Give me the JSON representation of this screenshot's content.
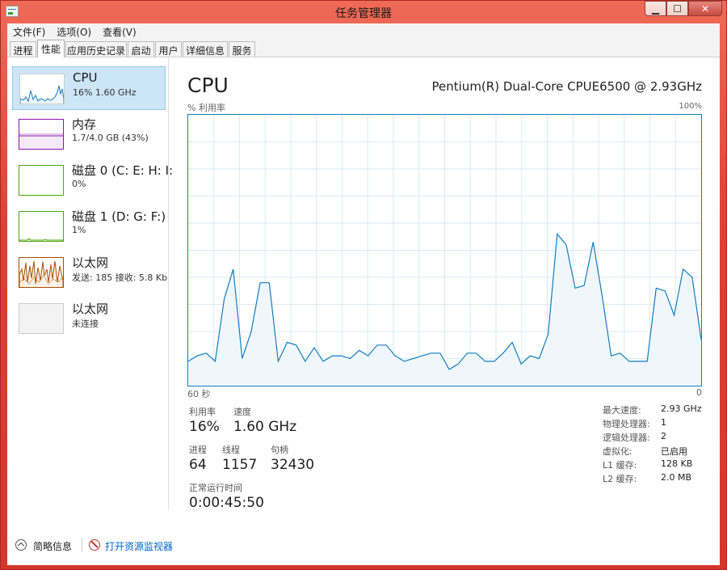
{
  "window": {
    "title": "任务管理器",
    "min": "▁",
    "max": "☐",
    "close": "✕"
  },
  "menu": [
    "文件(F)",
    "选项(O)",
    "查看(V)"
  ],
  "tabs": [
    "进程",
    "性能",
    "应用历史记录",
    "启动",
    "用户",
    "详细信息",
    "服务"
  ],
  "active_tab": 1,
  "sidebar": {
    "items": [
      {
        "title": "CPU",
        "sub": "16% 1.60 GHz",
        "color": "#117dbb",
        "fill": "#f0f7fc"
      },
      {
        "title": "内存",
        "sub": "1.7/4.0 GB (43%)",
        "color": "#8b12ae",
        "fill": "#f4eaf7"
      },
      {
        "title": "磁盘 0 (C: E: H: I:",
        "sub": "0%",
        "color": "#4da60c",
        "fill": "#f2f9ec"
      },
      {
        "title": "磁盘 1 (D: G: F:)",
        "sub": "1%",
        "color": "#4da60c",
        "fill": "#f2f9ec"
      },
      {
        "title": "以太网",
        "sub": "发送: 185  接收: 5.8 Kb",
        "color": "#a74f01",
        "fill": "#fbf1e8"
      },
      {
        "title": "以太网",
        "sub": "未连接",
        "color": "#cccccc",
        "fill": "#f3f3f3"
      }
    ]
  },
  "main": {
    "title": "CPU",
    "model": "Pentium(R) Dual-Core CPUE6500 @ 2.93GHz",
    "util_label": "% 利用率",
    "max_label": "100%",
    "time_left": "60 秒",
    "time_right": "0"
  },
  "stats": {
    "util_label": "利用率",
    "util_value": "16%",
    "speed_label": "速度",
    "speed_value": "1.60 GHz",
    "proc_label": "进程",
    "proc_value": "64",
    "thread_label": "线程",
    "thread_value": "1157",
    "handle_label": "句柄",
    "handle_value": "32430",
    "uptime_label": "正常运行时间",
    "uptime_value": "0:00:45:50"
  },
  "info": [
    {
      "label": "最大速度:",
      "value": "2.93 GHz"
    },
    {
      "label": "物理处理器:",
      "value": "1"
    },
    {
      "label": "逻辑处理器:",
      "value": "2"
    },
    {
      "label": "虚拟化:",
      "value": "已启用"
    },
    {
      "label": "L1 缓存:",
      "value": "128 KB"
    },
    {
      "label": "L2 缓存:",
      "value": "2.0 MB"
    }
  ],
  "bottom": {
    "collapse": "简略信息",
    "monitor": "打开资源监视器"
  },
  "chart_data": {
    "type": "area",
    "ylim": [
      0,
      100
    ],
    "color": "#117dbb",
    "fill": "#f0f7fc",
    "values": [
      9,
      11,
      12,
      9,
      32,
      43,
      10,
      20,
      38,
      38,
      9,
      16,
      15,
      9,
      14,
      9,
      11,
      11,
      10,
      13,
      11,
      15,
      15,
      11,
      9,
      10,
      11,
      12,
      12,
      6,
      8,
      12,
      12,
      9,
      9,
      12,
      16,
      8,
      11,
      10,
      19,
      56,
      52,
      36,
      37,
      53,
      33,
      11,
      12,
      9,
      9,
      9,
      36,
      35,
      26,
      43,
      40,
      17
    ]
  }
}
